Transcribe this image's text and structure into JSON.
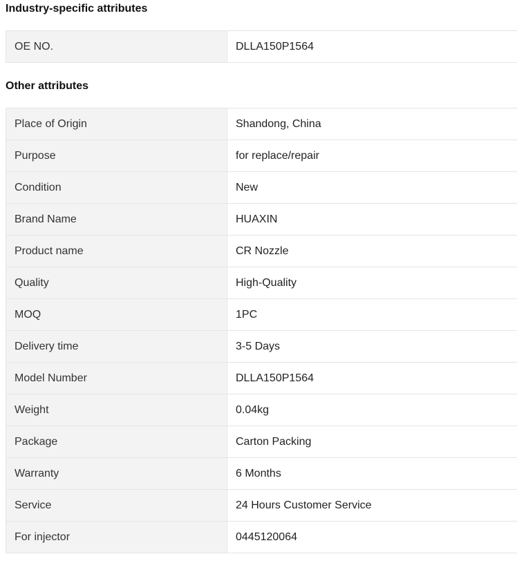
{
  "industry_section": {
    "title": "Industry-specific attributes",
    "rows": [
      {
        "key": "OE NO.",
        "value": "DLLA150P1564"
      }
    ]
  },
  "other_section": {
    "title": "Other attributes",
    "rows": [
      {
        "key": "Place of Origin",
        "value": "Shandong, China"
      },
      {
        "key": "Purpose",
        "value": "for replace/repair"
      },
      {
        "key": "Condition",
        "value": "New"
      },
      {
        "key": "Brand Name",
        "value": "HUAXIN"
      },
      {
        "key": "Product name",
        "value": "CR Nozzle"
      },
      {
        "key": "Quality",
        "value": "High-Quality"
      },
      {
        "key": "MOQ",
        "value": "1PC"
      },
      {
        "key": "Delivery time",
        "value": "3-5 Days"
      },
      {
        "key": "Model Number",
        "value": "DLLA150P1564"
      },
      {
        "key": "Weight",
        "value": "0.04kg"
      },
      {
        "key": "Package",
        "value": "Carton Packing"
      },
      {
        "key": "Warranty",
        "value": "6 Months"
      },
      {
        "key": "Service",
        "value": "24 Hours Customer Service"
      },
      {
        "key": "For injector",
        "value": "0445120064"
      }
    ]
  }
}
